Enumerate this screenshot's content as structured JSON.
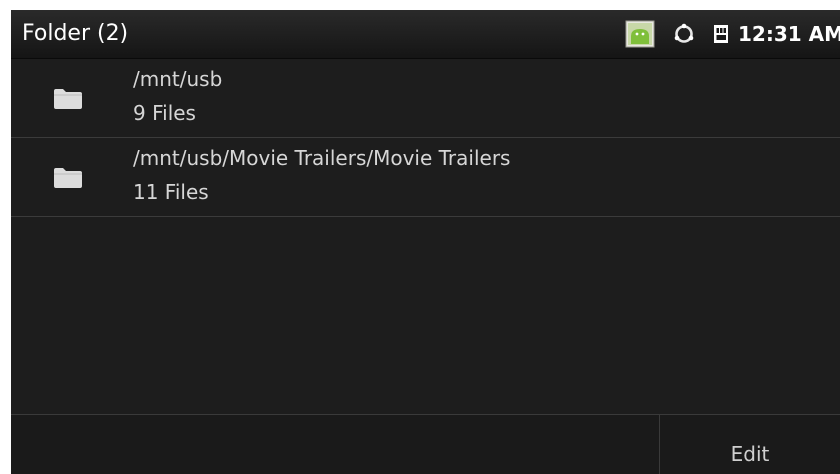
{
  "titlebar": {
    "title": "Folder (2)",
    "clock": "12:31 AM",
    "icons": [
      "android-notification-icon",
      "sync-icon",
      "sd-card-icon"
    ]
  },
  "folders": [
    {
      "path": "/mnt/usb",
      "count": "9 Files",
      "icon": "folder-icon"
    },
    {
      "path": "/mnt/usb/Movie Trailers/Movie Trailers",
      "count": "11 Files",
      "icon": "folder-icon"
    }
  ],
  "bottombar": {
    "edit_label": "Edit"
  },
  "colors": {
    "background": "#1d1d1d",
    "text": "#d6d6d6",
    "divider": "#3b3b3b",
    "android_green": "#8cc63f"
  }
}
